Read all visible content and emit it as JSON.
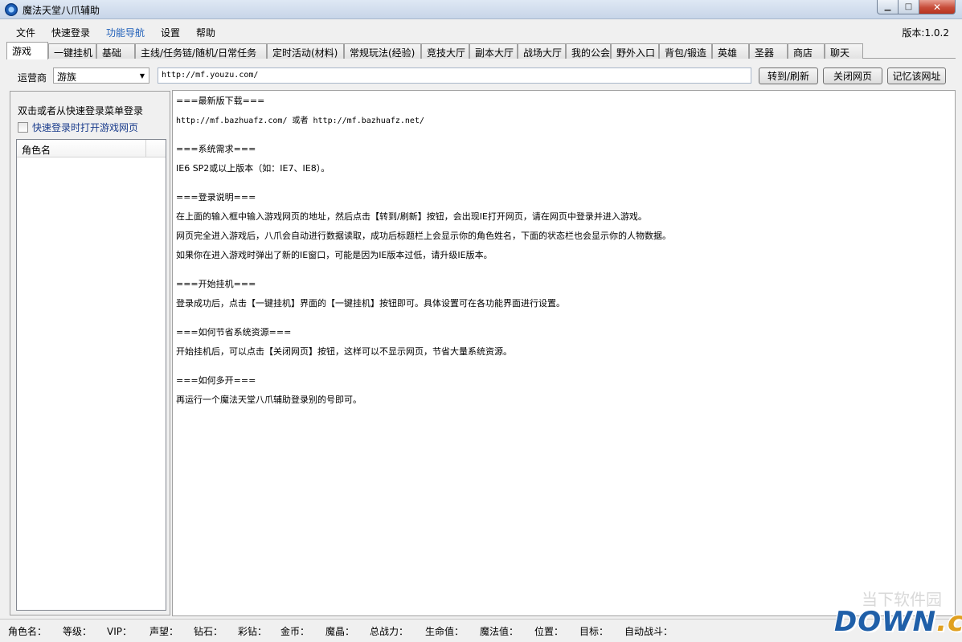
{
  "window": {
    "title": "魔法天堂八爪辅助",
    "min_symbol": "▁",
    "max_symbol": "□",
    "close_symbol": "✕"
  },
  "menu": {
    "items": [
      "文件",
      "快速登录",
      "功能导航",
      "设置",
      "帮助"
    ],
    "active_index": 2,
    "version": "版本:1.0.2"
  },
  "tabs": [
    "游戏",
    "一键挂机",
    "基础",
    "主线/任务链/随机/日常任务",
    "定时活动(材料)",
    "常规玩法(经验)",
    "竞技大厅",
    "副本大厅",
    "战场大厅",
    "我的公会",
    "野外入口",
    "背包/锻造",
    "英雄",
    "圣器",
    "商店",
    "聊天"
  ],
  "toolbar": {
    "operator_label": "运营商",
    "operator_value": "游族",
    "url_value": "http://mf.youzu.com/",
    "goto_button": "转到/刷新",
    "close_page_button": "关闭网页",
    "remember_button": "记忆该网址"
  },
  "left_panel": {
    "hint": "双击或者从快速登录菜单登录",
    "checkbox_label": "快速登录时打开游戏网页",
    "column_header": "角色名"
  },
  "content": {
    "lines": [
      "===最新版下载===",
      "http://mf.bazhuafz.com/ 或者 http://mf.bazhuafz.net/",
      "===系统需求===",
      "IE6 SP2或以上版本（如：IE7、IE8）。",
      "===登录说明===",
      "在上面的输入框中输入游戏网页的地址，然后点击【转到/刷新】按钮，会出现IE打开网页，请在网页中登录并进入游戏。",
      "网页完全进入游戏后，八爪会自动进行数据读取，成功后标题栏上会显示你的角色姓名，下面的状态栏也会显示你的人物数据。",
      "如果你在进入游戏时弹出了新的IE窗口，可能是因为IE版本过低，请升级IE版本。",
      "===开始挂机===",
      "登录成功后，点击【一键挂机】界面的【一键挂机】按钮即可。具体设置可在各功能界面进行设置。",
      "===如何节省系统资源===",
      "开始挂机后，可以点击【关闭网页】按钮，这样可以不显示网页，节省大量系统资源。",
      "===如何多开===",
      "再运行一个魔法天堂八爪辅助登录别的号即可。"
    ]
  },
  "statusbar": {
    "fields": [
      "角色名：",
      "等级：",
      "VIP：",
      "声望：",
      "钻石：",
      "彩钻：",
      "金币：",
      "魔晶：",
      "总战力：",
      "生命值：",
      "魔法值：",
      "位置：",
      "目标：",
      "自动战斗："
    ]
  },
  "watermark": {
    "main": "DOWN",
    "suffix": ".cc",
    "faint": "当下软件园"
  },
  "colors": {
    "menu_active": "#1e5eb8",
    "checkbox_label": "#1a3c8c",
    "watermark_blue": "#1f5fa8"
  }
}
